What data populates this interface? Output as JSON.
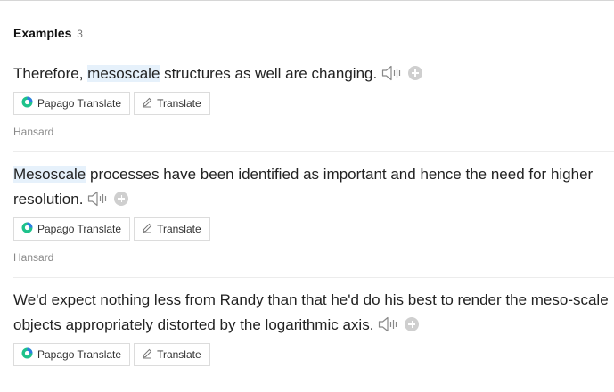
{
  "header": {
    "title": "Examples",
    "count": "3"
  },
  "examples": [
    {
      "pre": "Therefore, ",
      "highlight": "mesoscale",
      "post": " structures as well are changing.",
      "source": "Hansard"
    },
    {
      "pre": "",
      "highlight": "Mesoscale",
      "post": " processes have been identified as important and hence the need for higher resolution.",
      "source": "Hansard"
    },
    {
      "pre": "",
      "highlight": "",
      "post": "We'd expect nothing less from Randy than that he'd do his best to render the meso-scale objects appropriately distorted by the logarithmic axis.",
      "source": ""
    }
  ],
  "buttons": {
    "papago": "Papago Translate",
    "translate": "Translate"
  },
  "icons": {
    "papago": "papago-logo-icon",
    "translate": "pencil-icon",
    "speaker": "speaker-icon",
    "add": "plus-circle-icon"
  },
  "colors": {
    "highlight": "#e6f1fb",
    "plus": "#cfcfcf",
    "source": "#888888"
  }
}
